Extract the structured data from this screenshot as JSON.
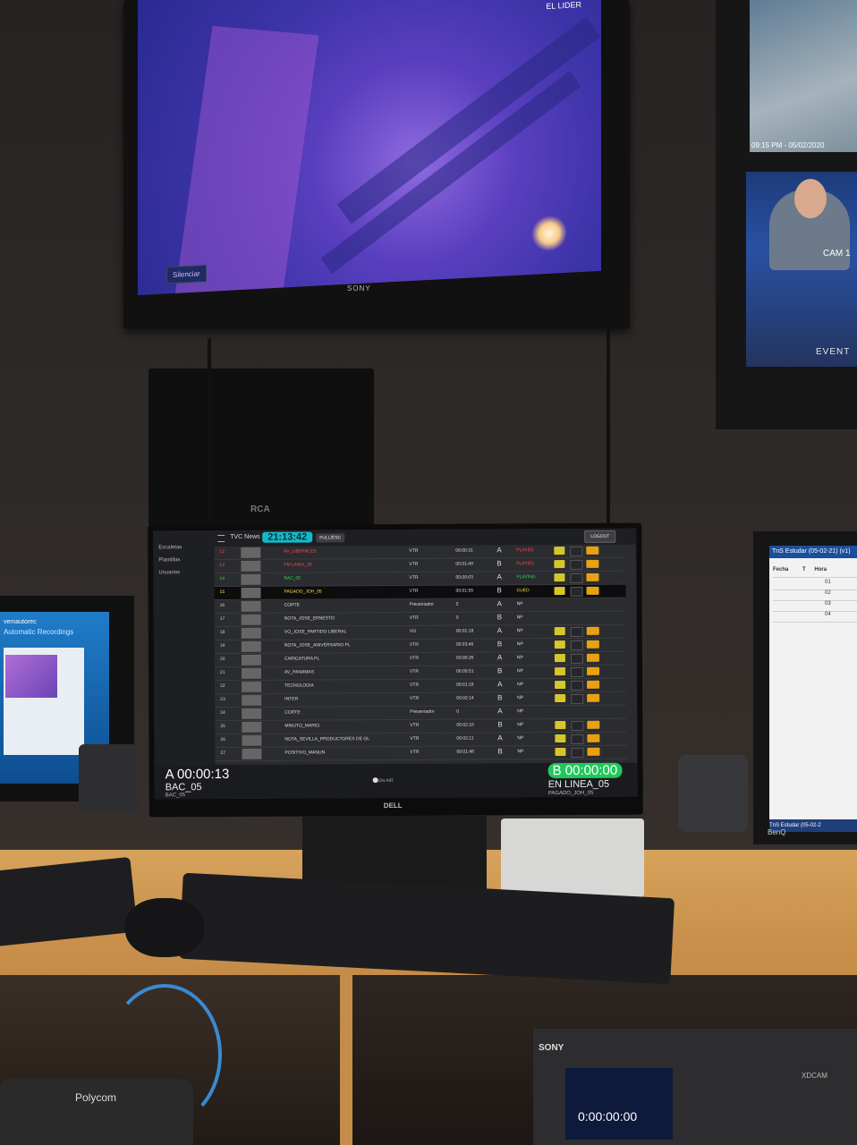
{
  "top_tv": {
    "channel_logo": "EL LIDER",
    "overlay_button": "Silenciar",
    "brand": "SONY"
  },
  "right_tv": {
    "timestamp": "09:15 PM - 05/02/2020",
    "camera_label": "CAM 1",
    "event_label": "EVENT"
  },
  "rca_monitor": {
    "brand": "RCA"
  },
  "left_monitor": {
    "title": "vemautorec",
    "subtitle": "Automatic Recordings"
  },
  "benq_monitor": {
    "window_title": "TnS Estudar (05-02-21) (v1)",
    "column_headers": [
      "Fecha",
      "T",
      "Hora"
    ],
    "rows": [
      "01",
      "02",
      "03",
      "04"
    ],
    "taskbar_item": "TnS Estudar (05-02-2",
    "brand": "BenQ"
  },
  "dell_monitor": {
    "brand": "DELL",
    "app_title": "TVC News",
    "clock": "21:13:42",
    "full_esc_label": "FULL/ESC",
    "logout_label": "LOGOUT",
    "sidebar": [
      "Escaletas",
      "Plantillas",
      "Usuarios"
    ],
    "rundown": [
      {
        "num": "12",
        "name": "AV_LIBERALES",
        "type": "VTR",
        "duration": "00:00:31",
        "channel": "A",
        "status": "PLAYED",
        "state": "played"
      },
      {
        "num": "13",
        "name": "FM LINEA_05",
        "type": "VTR",
        "duration": "00:01:49",
        "channel": "B",
        "status": "PLAYED",
        "state": "played"
      },
      {
        "num": "14",
        "name": "BAC_05",
        "type": "VTR",
        "duration": "00:00:03",
        "channel": "A",
        "status": "PLAYING",
        "state": "playing"
      },
      {
        "num": "15",
        "name": "PAGADO_JOH_05",
        "type": "VTR",
        "duration": "00:01:55",
        "channel": "B",
        "status": "CUED",
        "state": "cued"
      },
      {
        "num": "16",
        "name": "CORTE",
        "type": "Presentador",
        "duration": "0",
        "channel": "A",
        "status": "NP",
        "state": "np"
      },
      {
        "num": "17",
        "name": "NOTA_JOSE_ERNESTO",
        "type": "VTR",
        "duration": "0",
        "channel": "B",
        "status": "NP",
        "state": "np"
      },
      {
        "num": "18",
        "name": "VO_JOSE_PARTIDO LIBERAL",
        "type": "VO",
        "duration": "00:01:18",
        "channel": "A",
        "status": "NP",
        "state": "np"
      },
      {
        "num": "19",
        "name": "NOTA_JOSE_ANIVERSARIO PL",
        "type": "VTR",
        "duration": "00:03:46",
        "channel": "B",
        "status": "NP",
        "state": "np"
      },
      {
        "num": "20",
        "name": "CARICATURA PL",
        "type": "VTR",
        "duration": "00:00:26",
        "channel": "A",
        "status": "NP",
        "state": "np"
      },
      {
        "num": "21",
        "name": "AV_PANAMAS",
        "type": "VTR",
        "duration": "00:00:51",
        "channel": "B",
        "status": "NP",
        "state": "np"
      },
      {
        "num": "22",
        "name": "TECNOLOGIA",
        "type": "VTR",
        "duration": "00:01:15",
        "channel": "A",
        "status": "NP",
        "state": "np"
      },
      {
        "num": "23",
        "name": "INTER",
        "type": "VTR",
        "duration": "00:02:14",
        "channel": "B",
        "status": "NP",
        "state": "np"
      },
      {
        "num": "24",
        "name": "CORTE",
        "type": "Presentador",
        "duration": "0",
        "channel": "A",
        "status": "NP",
        "state": "np"
      },
      {
        "num": "25",
        "name": "MINUTO_MARIO",
        "type": "VTR",
        "duration": "00:02:10",
        "channel": "B",
        "status": "NP",
        "state": "np"
      },
      {
        "num": "26",
        "name": "NOTA_SEVILLA_PRODUCTORES DE OL",
        "type": "VTR",
        "duration": "00:02:11",
        "channel": "A",
        "status": "NP",
        "state": "np"
      },
      {
        "num": "27",
        "name": "POSITIVO_MANUN",
        "type": "VTR",
        "duration": "00:01:48",
        "channel": "B",
        "status": "NP",
        "state": "np"
      }
    ],
    "player_a": {
      "timecode": "A 00:00:13",
      "clip": "BAC_05",
      "clip_small": "BAC_05"
    },
    "on_air_label": "ON AIR",
    "player_b": {
      "timecode": "B 00:00:00",
      "clip": "EN LINEA_05",
      "clip_small": "PAGADO_JOH_05"
    },
    "colors": {
      "played": "#ff4a4a",
      "playing": "#29d94a",
      "cued": "#f2e23a",
      "np": "#dddddd",
      "clock_bg": "#14b9c9",
      "player_b_bg": "#21c85b"
    }
  },
  "desk_equipment": {
    "deck_brand": "SONY",
    "deck_model": "XDCAM",
    "deck_timecode": "0:00:00:00",
    "phone_brand": "Polycom"
  }
}
